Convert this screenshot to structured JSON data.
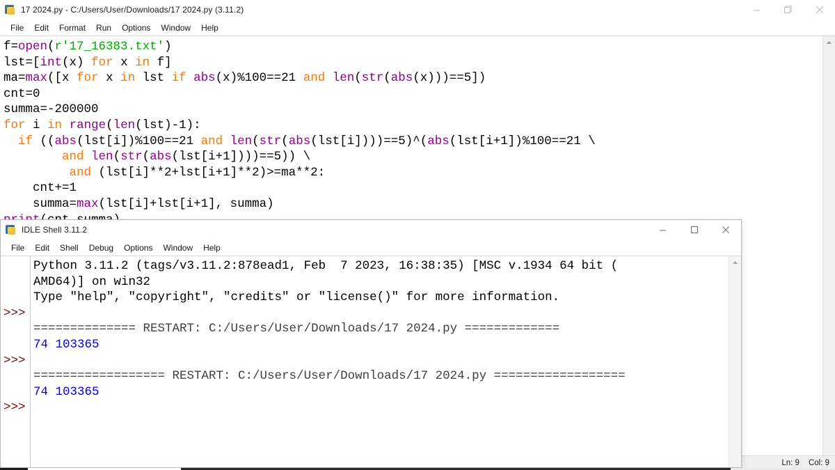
{
  "editor": {
    "title": "17 2024.py - C:/Users/User/Downloads/17 2024.py (3.11.2)",
    "icon": "python-idle-icon",
    "menus": [
      "File",
      "Edit",
      "Format",
      "Run",
      "Options",
      "Window",
      "Help"
    ],
    "window_controls": {
      "minimize": "minimize-icon",
      "maximize": "restore-icon",
      "close": "close-icon"
    },
    "status": {
      "line_label": "Ln: 9",
      "col_label": "Col: 9"
    },
    "code_lines": [
      [
        {
          "t": "f=",
          "c": "def"
        },
        {
          "t": "open",
          "c": "bi"
        },
        {
          "t": "(",
          "c": "def"
        },
        {
          "t": "r'17_16383.txt'",
          "c": "str"
        },
        {
          "t": ")",
          "c": "def"
        }
      ],
      [
        {
          "t": "lst=[",
          "c": "def"
        },
        {
          "t": "int",
          "c": "bi"
        },
        {
          "t": "(x) ",
          "c": "def"
        },
        {
          "t": "for",
          "c": "kw"
        },
        {
          "t": " x ",
          "c": "def"
        },
        {
          "t": "in",
          "c": "kw"
        },
        {
          "t": " f]",
          "c": "def"
        }
      ],
      [
        {
          "t": "ma=",
          "c": "def"
        },
        {
          "t": "max",
          "c": "bi"
        },
        {
          "t": "([x ",
          "c": "def"
        },
        {
          "t": "for",
          "c": "kw"
        },
        {
          "t": " x ",
          "c": "def"
        },
        {
          "t": "in",
          "c": "kw"
        },
        {
          "t": " lst ",
          "c": "def"
        },
        {
          "t": "if",
          "c": "kw"
        },
        {
          "t": " ",
          "c": "def"
        },
        {
          "t": "abs",
          "c": "bi"
        },
        {
          "t": "(x)%100==21 ",
          "c": "def"
        },
        {
          "t": "and",
          "c": "kw"
        },
        {
          "t": " ",
          "c": "def"
        },
        {
          "t": "len",
          "c": "bi"
        },
        {
          "t": "(",
          "c": "def"
        },
        {
          "t": "str",
          "c": "bi"
        },
        {
          "t": "(",
          "c": "def"
        },
        {
          "t": "abs",
          "c": "bi"
        },
        {
          "t": "(x)))==5])",
          "c": "def"
        }
      ],
      [
        {
          "t": "cnt=0",
          "c": "def"
        }
      ],
      [
        {
          "t": "summa=-200000",
          "c": "def"
        }
      ],
      [
        {
          "t": "for",
          "c": "kw"
        },
        {
          "t": " i ",
          "c": "def"
        },
        {
          "t": "in",
          "c": "kw"
        },
        {
          "t": " ",
          "c": "def"
        },
        {
          "t": "range",
          "c": "bi"
        },
        {
          "t": "(",
          "c": "def"
        },
        {
          "t": "len",
          "c": "bi"
        },
        {
          "t": "(lst)-1):",
          "c": "def"
        }
      ],
      [
        {
          "t": "  ",
          "c": "def"
        },
        {
          "t": "if",
          "c": "kw"
        },
        {
          "t": " ((",
          "c": "def"
        },
        {
          "t": "abs",
          "c": "bi"
        },
        {
          "t": "(lst[i])%100==21 ",
          "c": "def"
        },
        {
          "t": "and",
          "c": "kw"
        },
        {
          "t": " ",
          "c": "def"
        },
        {
          "t": "len",
          "c": "bi"
        },
        {
          "t": "(",
          "c": "def"
        },
        {
          "t": "str",
          "c": "bi"
        },
        {
          "t": "(",
          "c": "def"
        },
        {
          "t": "abs",
          "c": "bi"
        },
        {
          "t": "(lst[i])))==5)^(",
          "c": "def"
        },
        {
          "t": "abs",
          "c": "bi"
        },
        {
          "t": "(lst[i+1])%100==21 \\",
          "c": "def"
        }
      ],
      [
        {
          "t": "        ",
          "c": "def"
        },
        {
          "t": "and",
          "c": "kw"
        },
        {
          "t": " ",
          "c": "def"
        },
        {
          "t": "len",
          "c": "bi"
        },
        {
          "t": "(",
          "c": "def"
        },
        {
          "t": "str",
          "c": "bi"
        },
        {
          "t": "(",
          "c": "def"
        },
        {
          "t": "abs",
          "c": "bi"
        },
        {
          "t": "(lst[i+1])))==5)) \\",
          "c": "def"
        }
      ],
      [
        {
          "t": "         ",
          "c": "def"
        },
        {
          "t": "and",
          "c": "kw"
        },
        {
          "t": " (lst[i]**2+lst[i+1]**2)>=ma**2:",
          "c": "def"
        }
      ],
      [
        {
          "t": "    cnt+=1",
          "c": "def"
        }
      ],
      [
        {
          "t": "    summa=",
          "c": "def"
        },
        {
          "t": "max",
          "c": "bi"
        },
        {
          "t": "(lst[i]+lst[i+1], summa)",
          "c": "def"
        }
      ],
      [
        {
          "t": "print",
          "c": "bi"
        },
        {
          "t": "(cnt,summa)",
          "c": "def"
        }
      ]
    ]
  },
  "shell": {
    "title": "IDLE Shell 3.11.2",
    "icon": "python-idle-icon",
    "menus": [
      "File",
      "Edit",
      "Shell",
      "Debug",
      "Options",
      "Window",
      "Help"
    ],
    "window_controls": {
      "minimize": "minimize-icon",
      "maximize": "maximize-icon",
      "close": "close-icon"
    },
    "prompt_symbol": ">>>",
    "output_lines": [
      [
        {
          "t": "Python 3.11.2 (tags/v3.11.2:878ead1, Feb  7 2023, 16:38:35) [MSC v.1934 64 bit (",
          "c": "def"
        }
      ],
      [
        {
          "t": "AMD64)] on win32",
          "c": "def"
        }
      ],
      [
        {
          "t": "Type \"help\", \"copyright\", \"credits\" or \"license()\" for more information.",
          "c": "def"
        }
      ],
      [
        {
          "t": "",
          "c": "def"
        }
      ],
      [
        {
          "t": "============== RESTART: C:/Users/User/Downloads/17 2024.py =============",
          "c": "stdout-hdr"
        }
      ],
      [
        {
          "t": "74 103365",
          "c": "out"
        }
      ],
      [
        {
          "t": "",
          "c": "def"
        }
      ],
      [
        {
          "t": "================== RESTART: C:/Users/User/Downloads/17 2024.py ==================",
          "c": "stdout-hdr"
        }
      ],
      [
        {
          "t": "74 103365",
          "c": "out"
        }
      ],
      [
        {
          "t": "",
          "c": "def"
        }
      ]
    ],
    "prompt_rows": [
      3,
      6,
      9
    ]
  }
}
